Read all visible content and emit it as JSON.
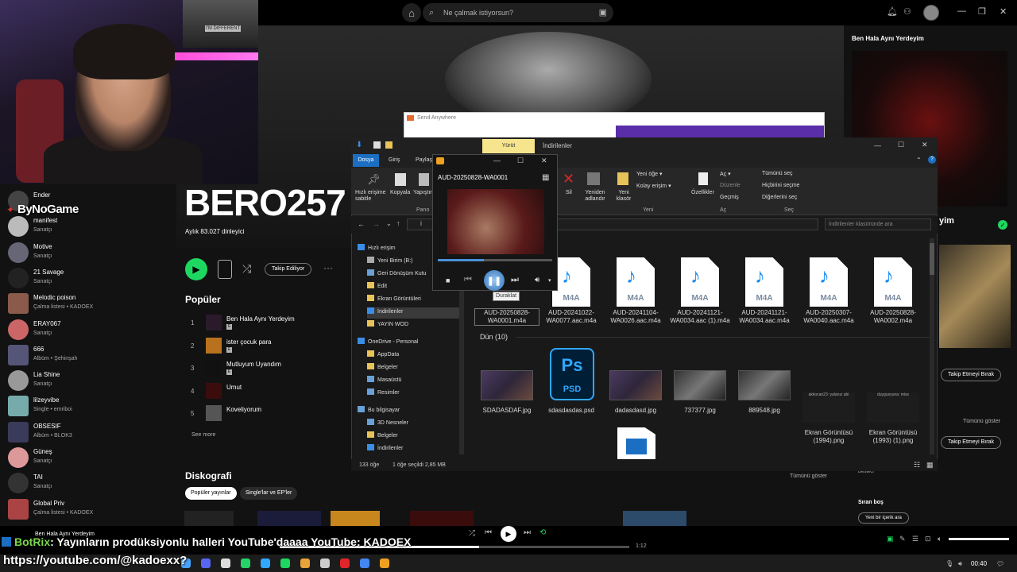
{
  "spotify": {
    "search_placeholder": "Ne çalmak istiyorsun?",
    "artist_name": "BERO257",
    "monthly_listeners": "Aylık 83.027 dinleyici",
    "follow_label": "Takip Ediliyor",
    "popular_title": "Popüler",
    "see_more": "See more",
    "discography_title": "Diskografi",
    "show_all": "Tümünü göster",
    "filters": [
      "Popüler yayınlar",
      "Single'lar ve EP'ler"
    ],
    "tracks": [
      {
        "num": "1",
        "name": "Ben Hala Aynı Yerdeyim"
      },
      {
        "num": "2",
        "name": "ister çocuk para"
      },
      {
        "num": "3",
        "name": "Mutluyum Uyandım"
      },
      {
        "num": "4",
        "name": "Umut"
      },
      {
        "num": "5",
        "name": "Koveliyorum"
      }
    ],
    "explicit_badge": "E",
    "library": [
      {
        "title": "Ender",
        "subtitle": ""
      },
      {
        "title": "manifest",
        "subtitle": "Sanatçı"
      },
      {
        "title": "Motive",
        "subtitle": "Sanatçı"
      },
      {
        "title": "21 Savage",
        "subtitle": "Sanatçı"
      },
      {
        "title": "Melodic poison",
        "subtitle": "Çalma listesi • KADOEX"
      },
      {
        "title": "ERAY067",
        "subtitle": "Sanatçı"
      },
      {
        "title": "666",
        "subtitle": "Albüm • Şehinşah"
      },
      {
        "title": "Lia Shine",
        "subtitle": "Sanatçı"
      },
      {
        "title": "lilzeyvibe",
        "subtitle": "Single • emriboi"
      },
      {
        "title": "OBSESIF",
        "subtitle": "Albüm • BLOK3"
      },
      {
        "title": "Güneş",
        "subtitle": "Sanatçı"
      },
      {
        "title": "TAI",
        "subtitle": "Sanatçı"
      },
      {
        "title": "Global Priv",
        "subtitle": "Çalma listesi • KADOEX"
      }
    ],
    "right_panel": {
      "title": "Ben Hala Aynı Yerdeyim",
      "artist": "yim",
      "unfollow": "Takip Etmeyi Bırak",
      "show_all": "Tümünü göster",
      "composer": "Besteci",
      "queue_title": "Sıradaki",
      "queue_prefix": "Sıran boş",
      "queue_button": "Yeni bir içerik ara"
    },
    "now_playing": "Ben Hala Aynı Yerdeyim",
    "elapsed": "1:12",
    "progress": 0.57
  },
  "webcam": {
    "brand": "ByNoGame",
    "poster_text": "I'M DIFFERENT"
  },
  "send_anywhere": {
    "title": "Send Anywhere"
  },
  "explorer": {
    "tool_tab": "Yürüt",
    "title": "İndirilenler",
    "tabs": [
      "Dosya",
      "Giriş",
      "Paylaş"
    ],
    "ribbon": {
      "pin": "Hızlı erişime sabitle",
      "copy": "Kopyala",
      "paste": "Yapıştır",
      "group_clipboard": "Pano",
      "delete": "Sil",
      "rename": "Yeniden adlandır",
      "new_folder": "Yeni klasör",
      "new_item": "Yeni öğe",
      "easy_access": "Kolay erişim",
      "group_new": "Yeni",
      "properties": "Özellikler",
      "open": "Aç",
      "edit": "Düzenle",
      "history": "Geçmiş",
      "group_open": "Aç",
      "select_all": "Tümünü seç",
      "select_none": "Hiçbirini seçme",
      "invert": "Diğerlerini seç",
      "group_select": "Seç"
    },
    "address": "İ",
    "search_placeholder": "İndirilenler klasöründe ara",
    "nav": [
      {
        "label": "Hızlı erişim",
        "indent": 0,
        "color": "#3a8ee6"
      },
      {
        "label": "Yeni Birim (B:)",
        "indent": 1,
        "color": "#aaa"
      },
      {
        "label": "Geri Dönüşüm Kutu",
        "indent": 1,
        "color": "#6aa0d6"
      },
      {
        "label": "Edit",
        "indent": 1,
        "color": "#e8c35a"
      },
      {
        "label": "Ekran Görüntüleri",
        "indent": 1,
        "color": "#e8c35a"
      },
      {
        "label": "İndirilenler",
        "indent": 1,
        "color": "#3a8ee6",
        "selected": true
      },
      {
        "label": "YAYIN WOD",
        "indent": 1,
        "color": "#e8c35a"
      },
      {
        "label": "OneDrive - Personal",
        "indent": 0,
        "color": "#3a8ee6"
      },
      {
        "label": "AppData",
        "indent": 1,
        "color": "#e8c35a"
      },
      {
        "label": "Belgeler",
        "indent": 1,
        "color": "#e8c35a"
      },
      {
        "label": "Masaüstü",
        "indent": 1,
        "color": "#6aa0d6"
      },
      {
        "label": "Resimler",
        "indent": 1,
        "color": "#6aa0d6"
      },
      {
        "label": "Bu bilgisayar",
        "indent": 0,
        "color": "#6aa0d6"
      },
      {
        "label": "3D Nesneler",
        "indent": 1,
        "color": "#6aa0d6"
      },
      {
        "label": "Belgeler",
        "indent": 1,
        "color": "#e8c35a"
      },
      {
        "label": "İndirilenler",
        "indent": 1,
        "color": "#3a8ee6"
      }
    ],
    "files_top": [
      {
        "name": "AUD-20250828-WA0001.m4a",
        "ext": "",
        "selected": true
      },
      {
        "name": "AUD-20241022-WA0077.aac.m4a",
        "ext": "M4A"
      },
      {
        "name": "AUD-20241104-WA0026.aac.m4a",
        "ext": "M4A"
      },
      {
        "name": "AUD-20241121-WA0034.aac (1).m4a",
        "ext": "M4A"
      },
      {
        "name": "AUD-20241121-WA0034.aac.m4a",
        "ext": "M4A"
      },
      {
        "name": "AUD-20250307-WA0040.aac.m4a",
        "ext": "M4A"
      },
      {
        "name": "AUD-20250828-WA0002.m4a",
        "ext": "M4A"
      }
    ],
    "group_yesterday": "Dün (10)",
    "files_bottom": [
      {
        "name": "SDADASDAF.jpg"
      },
      {
        "name": "sdasdasdas.psd"
      },
      {
        "name": "dadasdasd.jpg"
      },
      {
        "name": "737377.jpg"
      },
      {
        "name": "889548.jpg"
      },
      {
        "name": "Ekran Görüntüsü (1994).png",
        "caption": "akkocan23: yalanız abi"
      },
      {
        "name": "Ekran Görüntüsü (1993) (1).png",
        "caption": "duygusyuna: miss"
      }
    ],
    "ps_icon": "Ps",
    "ps_label": "PSD",
    "status_count": "133 öğe",
    "status_selected": "1 öğe seçildi  2,85 MB"
  },
  "media_player": {
    "title": "AUD-20250828-WA0001",
    "tooltip": "Duraklat",
    "progress": 0.4
  },
  "chat": {
    "user": "BotRix",
    "message": ": Yayınların prodüksiyonlu halleri YouTube'daaaa YouTube: KADOEX",
    "url": "https://youtube.com/@kadoexx?"
  },
  "taskbar": {
    "clock": "00:40"
  },
  "colors": {
    "spotify_green": "#1ed760",
    "ribbon_blue": "#1b6fc2",
    "ps_blue": "#31a8ff"
  }
}
